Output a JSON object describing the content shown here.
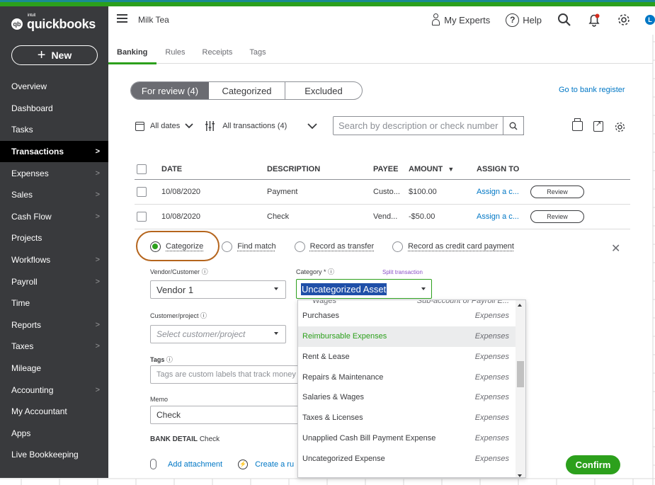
{
  "app": {
    "brand": "quickbooks",
    "brand_intuit": "intuit",
    "company": "Milk Tea"
  },
  "colors": {
    "accent": "#2ca01c",
    "sidebar": "#393a3d",
    "link": "#0077c5"
  },
  "header": {
    "experts": "My Experts",
    "help": "Help",
    "help_icon": "?",
    "user_initial": "L"
  },
  "sidebar": {
    "new_label": "New",
    "items": [
      {
        "label": "Overview",
        "chevron": false
      },
      {
        "label": "Dashboard",
        "chevron": false
      },
      {
        "label": "Tasks",
        "chevron": false
      },
      {
        "label": "Transactions",
        "chevron": true,
        "active": true
      },
      {
        "label": "Expenses",
        "chevron": true
      },
      {
        "label": "Sales",
        "chevron": true
      },
      {
        "label": "Cash Flow",
        "chevron": true
      },
      {
        "label": "Projects",
        "chevron": false
      },
      {
        "label": "Workflows",
        "chevron": true
      },
      {
        "label": "Payroll",
        "chevron": true
      },
      {
        "label": "Time",
        "chevron": false
      },
      {
        "label": "Reports",
        "chevron": true
      },
      {
        "label": "Taxes",
        "chevron": true
      },
      {
        "label": "Mileage",
        "chevron": false
      },
      {
        "label": "Accounting",
        "chevron": true
      },
      {
        "label": "My Accountant",
        "chevron": false
      },
      {
        "label": "Apps",
        "chevron": false
      },
      {
        "label": "Live Bookkeeping",
        "chevron": false
      }
    ]
  },
  "tabs": [
    "Banking",
    "Rules",
    "Receipts",
    "Tags"
  ],
  "segments": {
    "review": "For review (4)",
    "categorized": "Categorized",
    "excluded": "Excluded"
  },
  "go_to_register": "Go to bank register",
  "filters": {
    "dates": "All dates",
    "transactions": "All transactions (4)",
    "search_placeholder": "Search by description or check number"
  },
  "table": {
    "headers": {
      "date": "DATE",
      "description": "DESCRIPTION",
      "payee": "PAYEE",
      "amount": "AMOUNT",
      "assign": "ASSIGN TO"
    },
    "rows": [
      {
        "date": "10/08/2020",
        "description": "Payment",
        "payee": "Custo...",
        "amount": "$100.00",
        "assign": "Assign a c...",
        "action": "Review"
      },
      {
        "date": "10/08/2020",
        "description": "Check",
        "payee": "Vend...",
        "amount": "-$50.00",
        "assign": "Assign a c...",
        "action": "Review"
      }
    ]
  },
  "expand": {
    "options": [
      "Categorize",
      "Find match",
      "Record as transfer",
      "Record as credit card payment"
    ],
    "vendor_label": "Vendor/Customer",
    "vendor_value": "Vendor 1",
    "category_label": "Category *",
    "category_value": "Uncategorized Asset",
    "split": "Split transaction",
    "customer_label": "Customer/project",
    "customer_placeholder": "Select customer/project",
    "tags_label": "Tags",
    "tags_placeholder": "Tags are custom labels that track money",
    "memo_label": "Memo",
    "memo_value": "Check",
    "bank_detail_label": "BANK DETAIL",
    "bank_detail_value": "Check",
    "add_attachment": "Add attachment",
    "create_rule": "Create a ru",
    "confirm": "Confirm"
  },
  "dropdown": {
    "partial": {
      "label": "Wages",
      "type": "Sub-account of Payroll E..."
    },
    "items": [
      {
        "label": "Purchases",
        "type": "Expenses"
      },
      {
        "label": "Reimbursable Expenses",
        "type": "Expenses",
        "highlighted": true
      },
      {
        "label": "Rent & Lease",
        "type": "Expenses"
      },
      {
        "label": "Repairs & Maintenance",
        "type": "Expenses"
      },
      {
        "label": "Salaries & Wages",
        "type": "Expenses"
      },
      {
        "label": "Taxes & Licenses",
        "type": "Expenses"
      },
      {
        "label": "Unapplied Cash Bill Payment Expense",
        "type": "Expenses"
      },
      {
        "label": "Uncategorized Expense",
        "type": "Expenses"
      }
    ]
  }
}
